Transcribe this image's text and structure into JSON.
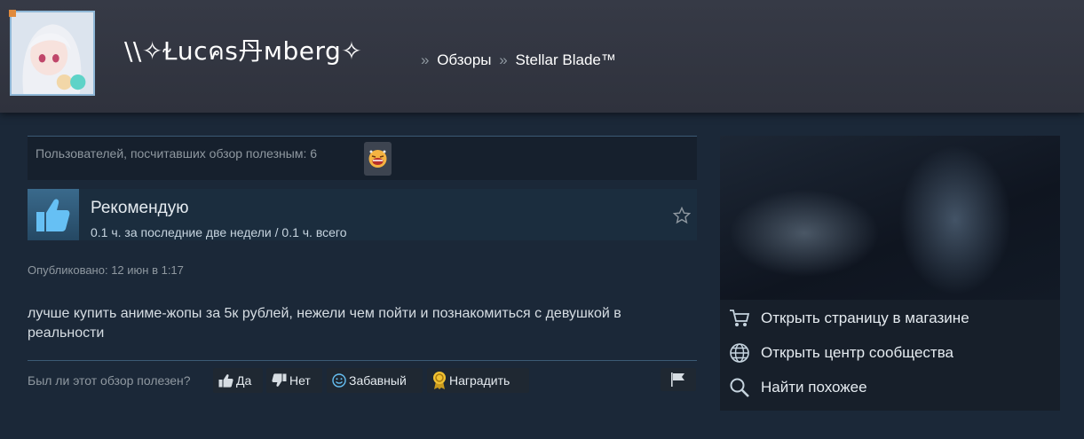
{
  "header": {
    "persona_name": "\\\\✧Ɫucคs丹мberg✧",
    "breadcrumb": [
      {
        "label": "Обзоры"
      },
      {
        "label": "Stellar Blade™"
      }
    ],
    "breadcrumb_separator": "»"
  },
  "review": {
    "helpful_text": "Пользователей, посчитавших обзор полезным: 6",
    "award_icon": "laughing-face-icon",
    "verdict": "Рекомендую",
    "hours": "0.1 ч. за последние две недели / 0.1 ч. всего",
    "posted": "Опубликовано: 12 июн в 1:17",
    "text": "лучше купить аниме-жопы за 5к рублей, нежели чем пойти и познакомиться с девушкой в реальности"
  },
  "vote": {
    "question": "Был ли этот обзор полезен?",
    "yes": "Да",
    "no": "Нет",
    "funny": "Забавный",
    "award": "Наградить"
  },
  "side": {
    "links": [
      {
        "label": "Открыть страницу в магазине",
        "icon": "cart-icon"
      },
      {
        "label": "Открыть центр сообщества",
        "icon": "globe-icon"
      },
      {
        "label": "Найти похожее",
        "icon": "search-icon"
      }
    ]
  },
  "colors": {
    "background": "#1b2838",
    "header": "#32353f",
    "accent_thumb": "#3a6a8c",
    "award_gold": "#f1c232"
  }
}
